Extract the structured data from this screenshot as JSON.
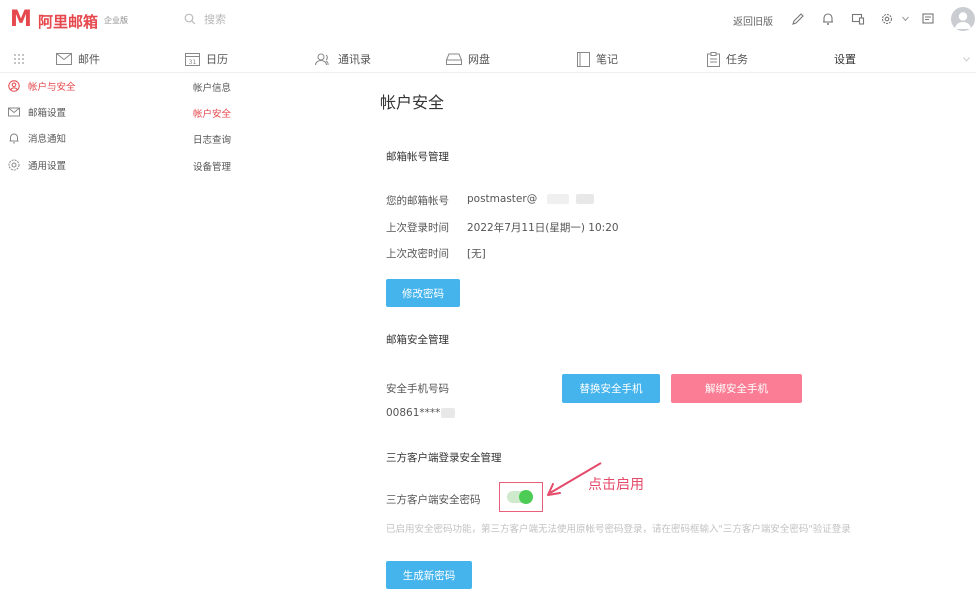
{
  "header": {
    "logo_mark": "M",
    "logo_text": "阿里邮箱",
    "logo_badge": "企业版",
    "search_placeholder": "搜索",
    "back_to_old": "返回旧版"
  },
  "nav": {
    "items": [
      {
        "label": "邮件"
      },
      {
        "label": "日历"
      },
      {
        "label": "通讯录"
      },
      {
        "label": "网盘"
      },
      {
        "label": "笔记"
      },
      {
        "label": "任务"
      },
      {
        "label": "设置"
      }
    ]
  },
  "sidebar": {
    "items": [
      {
        "label": "帐户与安全"
      },
      {
        "label": "邮箱设置"
      },
      {
        "label": "消息通知"
      },
      {
        "label": "通用设置"
      }
    ],
    "subitems": [
      {
        "label": "帐户信息"
      },
      {
        "label": "帐户安全"
      },
      {
        "label": "日志查询"
      },
      {
        "label": "设备管理"
      }
    ]
  },
  "content": {
    "title": "帐户安全",
    "mailbox_account": {
      "section_title": "邮箱帐号管理",
      "account_label": "您的邮箱帐号",
      "account_value": "postmaster@",
      "last_login_label": "上次登录时间",
      "last_login_value": "2022年7月11日(星期一) 10:20",
      "last_change_label": "上次改密时间",
      "last_change_value": "[无]",
      "change_password_btn": "修改密码"
    },
    "mailbox_security": {
      "section_title": "邮箱安全管理",
      "phone_label": "安全手机号码",
      "phone_value": "00861****",
      "replace_phone_btn": "替换安全手机",
      "unbind_phone_btn": "解绑安全手机"
    },
    "third_party": {
      "section_title": "三方客户端登录安全管理",
      "password_label": "三方客户端安全密码",
      "hint": "已启用安全密码功能，第三方客户端无法使用原帐号密码登录，请在密码框输入\"三方客户端安全密码\"验证登录",
      "generate_btn": "生成新密码",
      "toggle_on": true
    },
    "annotation": "点击启用"
  },
  "colors": {
    "brand_red": "#e5484d",
    "button_blue": "#45b4ec",
    "button_pink": "#fb7d95",
    "toggle_green": "#4ccc55",
    "annotation": "#e54a6a"
  }
}
